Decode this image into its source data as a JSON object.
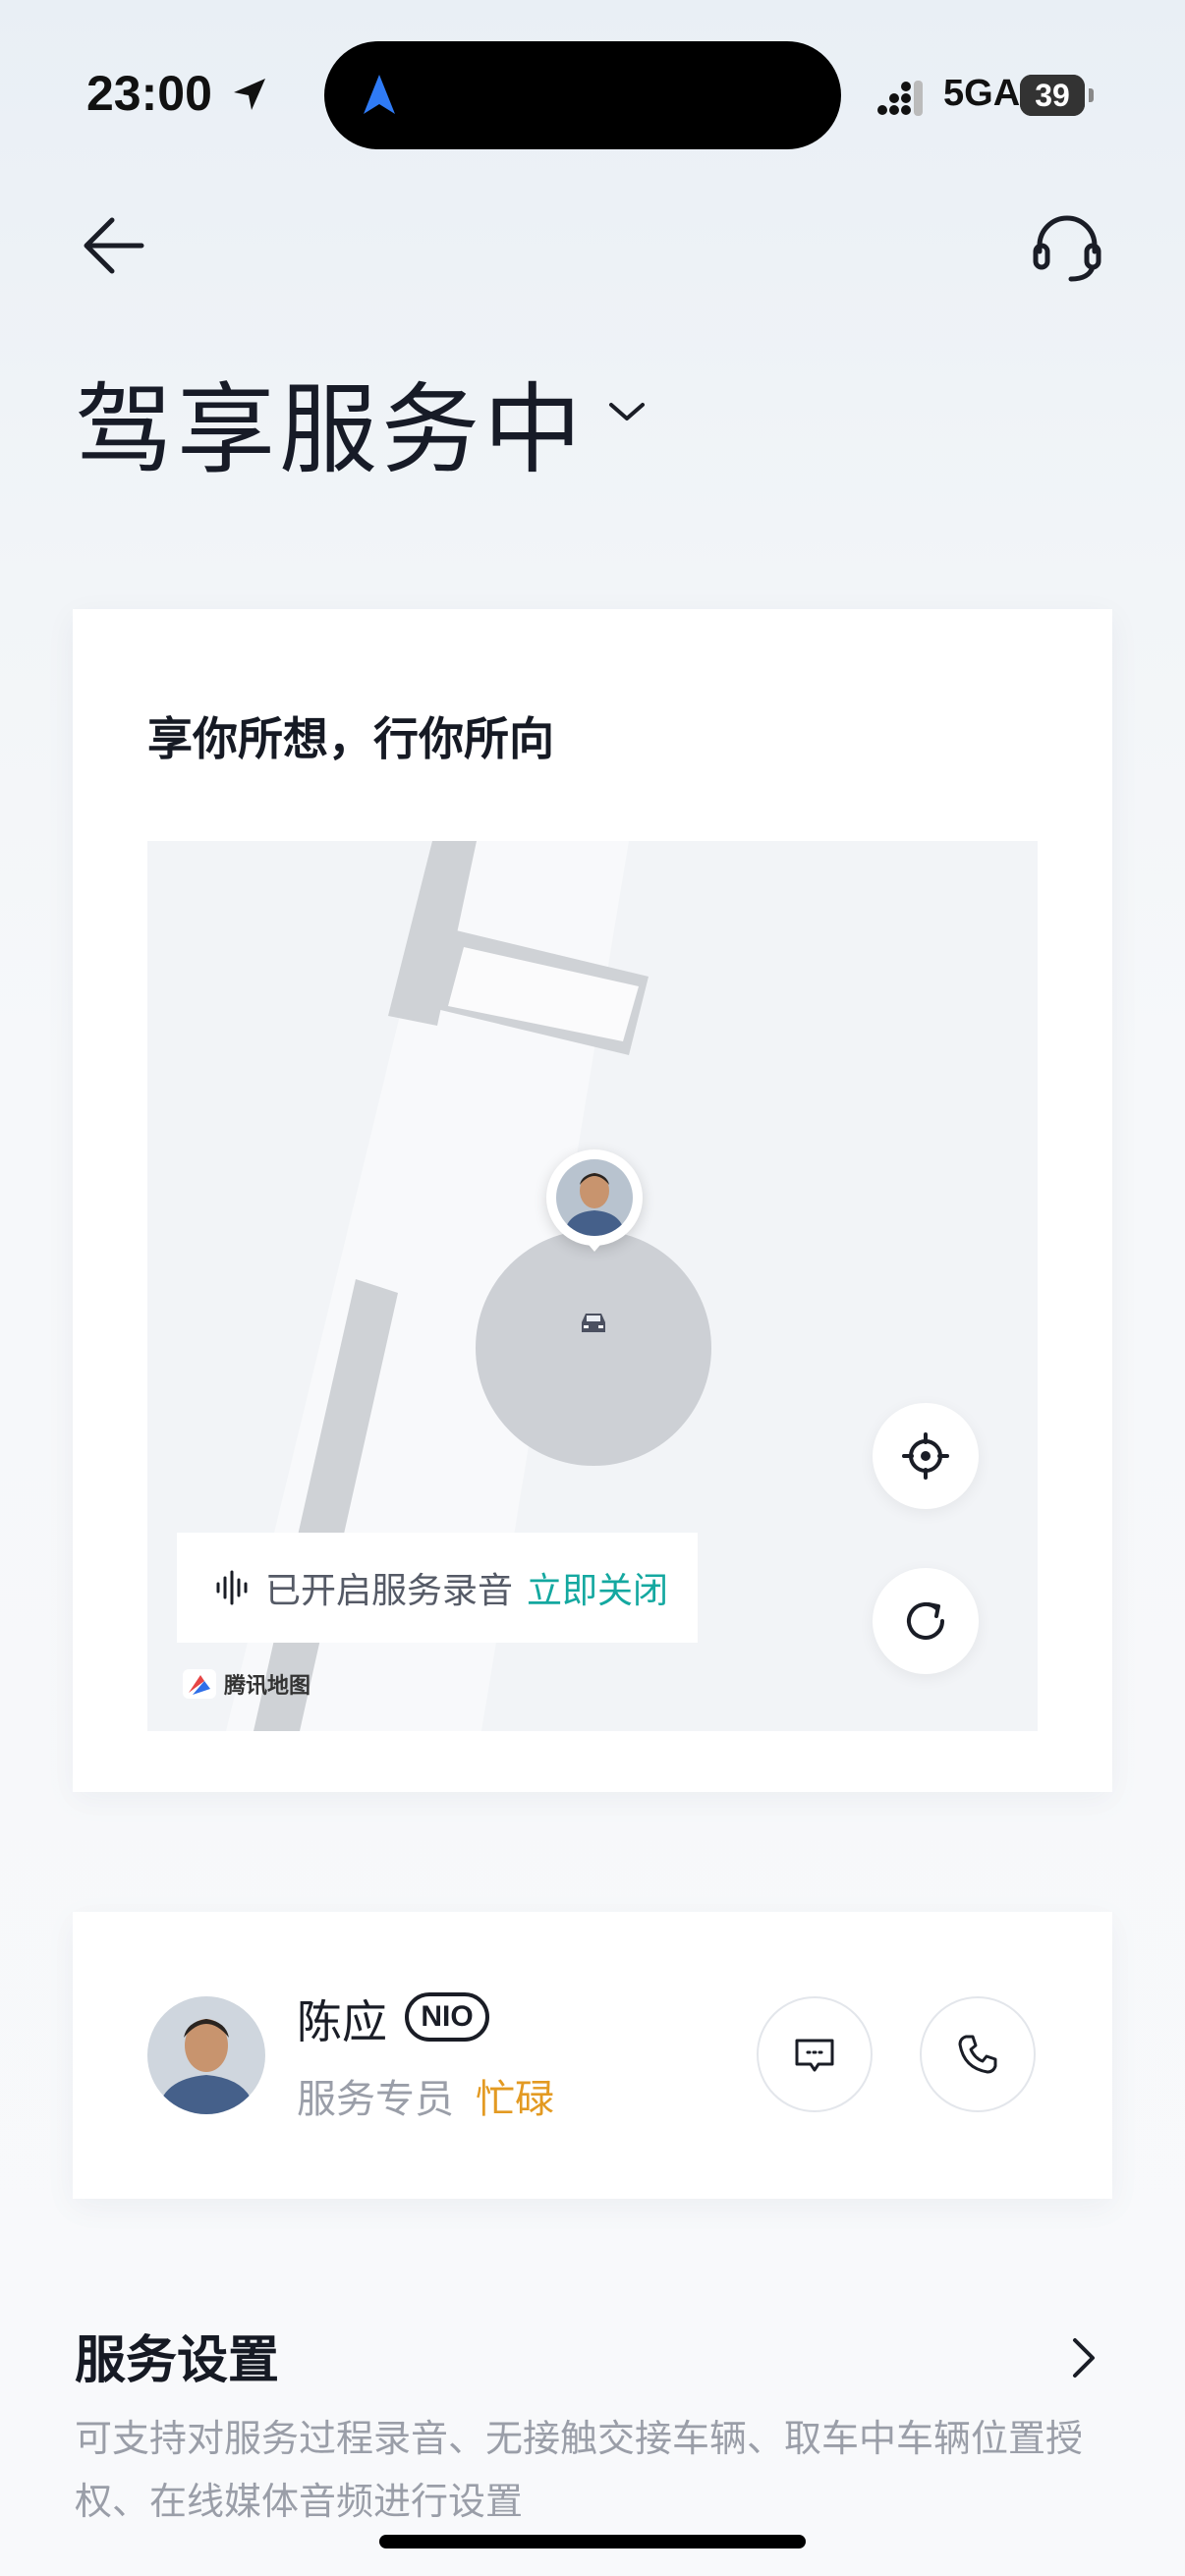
{
  "status_bar": {
    "time": "23:00",
    "network": "5GA",
    "battery": "39",
    "icons": [
      "location-arrow-icon",
      "navigation-icon",
      "signal-icon"
    ]
  },
  "nav": {
    "back_icon": "back-arrow-icon",
    "support_icon": "headset-icon"
  },
  "page": {
    "title": "驾享服务中"
  },
  "map_card": {
    "title": "享你所想，行你所向",
    "record_text": "已开启服务录音",
    "record_action": "立即关闭",
    "map_provider": "腾讯地图"
  },
  "staff": {
    "name": "陈应",
    "brand_badge": "NIO",
    "role": "服务专员",
    "status": "忙碌",
    "status_color": "#e39a22"
  },
  "settings": {
    "title": "服务设置",
    "description": "可支持对服务过程录音、无接触交接车辆、取车中车辆位置授权、在线媒体音频进行设置"
  },
  "colors": {
    "accent_teal": "#14a8a0",
    "title_text": "#171b27",
    "muted_text": "#9a9ea8"
  }
}
